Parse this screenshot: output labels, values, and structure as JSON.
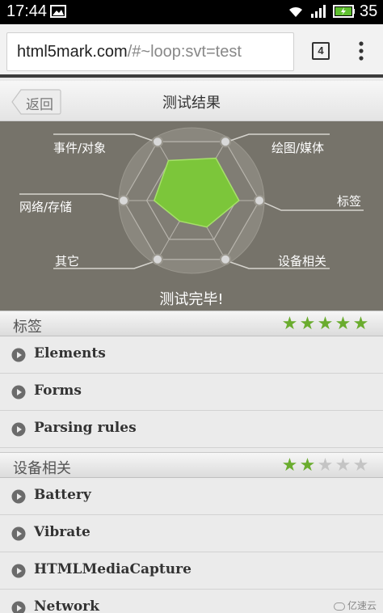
{
  "status_bar": {
    "time": "17:44",
    "battery_level": "35",
    "icons": [
      "image-icon",
      "wifi-icon",
      "signal-icon",
      "battery-icon"
    ]
  },
  "browser": {
    "url_host": "html5mark.com",
    "url_rest": "/#~loop:svt=test",
    "tab_count": "4"
  },
  "header": {
    "back_label": "返回",
    "title": "测试结果"
  },
  "result": {
    "labels": {
      "events": "事件/对象",
      "graphics": "绘图/媒体",
      "network": "网络/存储",
      "tags": "标签",
      "other": "其它",
      "device": "设备相关"
    },
    "scores": {
      "graphics": 0.72,
      "tags": 0.7,
      "device": 0.45,
      "other": 0.35,
      "network": 0.55,
      "events": 0.68
    },
    "done_text": "测试完毕!",
    "colors": {
      "fill": "#7cc63a",
      "panel": "#76736a"
    }
  },
  "sections": [
    {
      "title": "标签",
      "stars": 5,
      "max_stars": 5,
      "items": [
        "Elements",
        "Forms",
        "Parsing rules"
      ]
    },
    {
      "title": "设备相关",
      "stars": 2,
      "max_stars": 5,
      "items": [
        "Battery",
        "Vibrate",
        "HTMLMediaCapture",
        "Network"
      ]
    }
  ],
  "watermark": "亿速云"
}
